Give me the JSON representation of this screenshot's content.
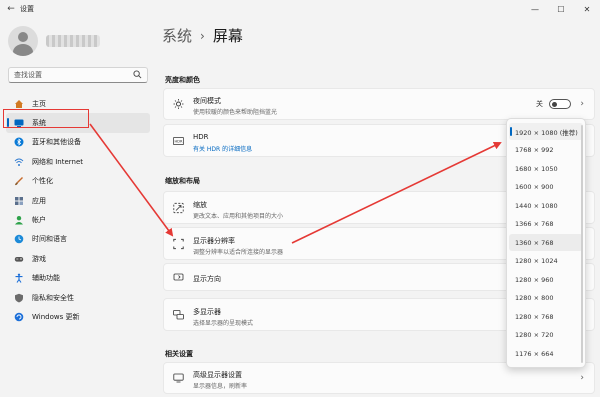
{
  "window": {
    "title": "设置",
    "minimize": "—",
    "maximize": "☐",
    "close": "✕"
  },
  "search": {
    "placeholder": "查找设置"
  },
  "breadcrumb": {
    "root": "系统",
    "separator": "›",
    "current": "屏幕"
  },
  "nav": {
    "items": [
      {
        "label": "主页",
        "icon": "home-icon",
        "color": "#d17a22"
      },
      {
        "label": "系统",
        "icon": "monitor-icon",
        "color": "#0067c0"
      },
      {
        "label": "蓝牙和其他设备",
        "icon": "bluetooth-icon",
        "color": "#0a7ad6"
      },
      {
        "label": "网络和 Internet",
        "icon": "wifi-icon",
        "color": "#2f7bd0"
      },
      {
        "label": "个性化",
        "icon": "brush-icon",
        "color": "#c86b2a"
      },
      {
        "label": "应用",
        "icon": "apps-icon",
        "color": "#5a6f8c"
      },
      {
        "label": "帐户",
        "icon": "person-icon",
        "color": "#2ea24a"
      },
      {
        "label": "时间和语言",
        "icon": "globe-clock-icon",
        "color": "#1c8ad8"
      },
      {
        "label": "游戏",
        "icon": "gamepad-icon",
        "color": "#555555"
      },
      {
        "label": "辅助功能",
        "icon": "accessibility-icon",
        "color": "#1c6fd8"
      },
      {
        "label": "隐私和安全性",
        "icon": "shield-icon",
        "color": "#6b6b6b"
      },
      {
        "label": "Windows 更新",
        "icon": "update-icon",
        "color": "#1c6fd8"
      }
    ]
  },
  "sections": {
    "brightness": "亮度和颜色",
    "scale": "缩放和布局",
    "related": "相关设置"
  },
  "cards": {
    "night": {
      "title": "夜间模式",
      "subtitle": "使用较暖的颜色来帮助阻挡蓝光",
      "toggle_label": "关"
    },
    "hdr": {
      "title": "HDR",
      "subtitle": "有关 HDR 的详细信息"
    },
    "scale": {
      "title": "缩放",
      "subtitle": "更改文本、应用和其他项目的大小"
    },
    "resolution": {
      "title": "显示器分辨率",
      "subtitle": "调整分辨率以适合所连接的显示器"
    },
    "orientation": {
      "title": "显示方向"
    },
    "multi": {
      "title": "多显示器",
      "subtitle": "选择显示器的呈现模式"
    },
    "advanced": {
      "title": "高级显示器设置",
      "subtitle": "显示器信息，刷新率"
    }
  },
  "resolution_options": [
    "1920 × 1080 (推荐)",
    "1768 × 992",
    "1680 × 1050",
    "1600 × 900",
    "1440 × 1080",
    "1366 × 768",
    "1360 × 768",
    "1280 × 1024",
    "1280 × 960",
    "1280 × 800",
    "1280 × 768",
    "1280 × 720",
    "1176 × 664"
  ],
  "selected_resolution_index": 0,
  "colors": {
    "accent": "#0067c0",
    "annotation": "#e53935"
  }
}
